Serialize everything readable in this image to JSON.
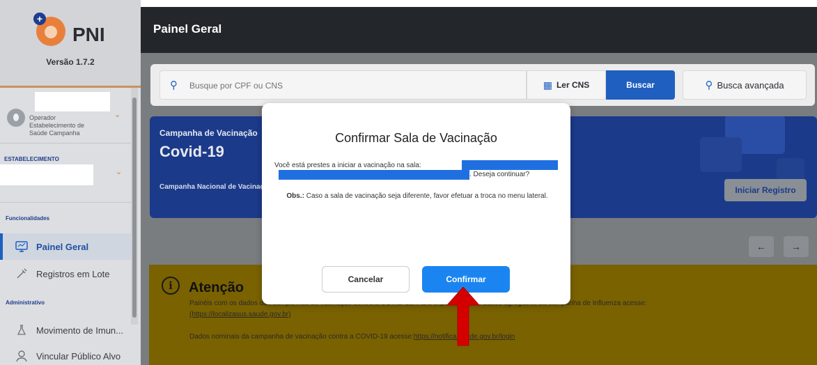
{
  "app": {
    "name": "PNI",
    "version": "Versão 1.7.2"
  },
  "sidebar": {
    "operator": {
      "line1": "Operador",
      "line2": "Estabelecimento de",
      "line3": "Saúde Campanha"
    },
    "estab_label": "ESTABELECIMENTO",
    "sections": {
      "funcionalidades": "Funcionalidades",
      "administrativo": "Administrativo"
    },
    "items": [
      {
        "label": "Painel Geral",
        "icon": "monitor-icon",
        "active": true
      },
      {
        "label": "Registros em Lote",
        "icon": "syringe-icon",
        "active": false
      },
      {
        "label": "Movimento de Imun...",
        "icon": "flask-icon",
        "active": false
      },
      {
        "label": "Vincular Público Alvo",
        "icon": "user-icon",
        "active": false
      }
    ]
  },
  "header": {
    "title": "Painel Geral"
  },
  "search": {
    "placeholder": "Busque por CPF ou CNS",
    "ler_cns": "Ler CNS",
    "buscar": "Buscar",
    "busca_avancada": "Busca avançada"
  },
  "campaign": {
    "heading": "Campanha de Vacinação",
    "name": "Covid-19",
    "subtitle": "Campanha Nacional de Vacinação",
    "button": "Iniciar Registro"
  },
  "carousel": {
    "prev": "←",
    "next": "→"
  },
  "attention": {
    "title": "Atenção",
    "text1": "Painéis com os dados das campanhas de vacinação contra a COVID-19. Para exportação dos dados agregados da campanha de Influenza acesse:",
    "link1": "(https://localizasus.saude.gov.br)",
    "text2": "Dados nominais da campanha de vacinação contra a COVID-19 acesse:",
    "link2": "https://notifica.saude.gov.br/login"
  },
  "modal": {
    "title": "Confirmar Sala de Vacinação",
    "body_prefix": "Você está prestes a iniciar a vacinação na sala:",
    "body_suffix": ". Deseja continuar?",
    "obs_label": "Obs.:",
    "obs_text": " Caso a sala de vacinação seja diferente, favor efetuar a troca no menu lateral.",
    "cancel": "Cancelar",
    "confirm": "Confirmar"
  },
  "colors": {
    "primary": "#1a85f0",
    "brand_dark_blue": "#1c3a8a",
    "attention_yellow": "#f2c500",
    "arrow_red": "#d40000"
  }
}
